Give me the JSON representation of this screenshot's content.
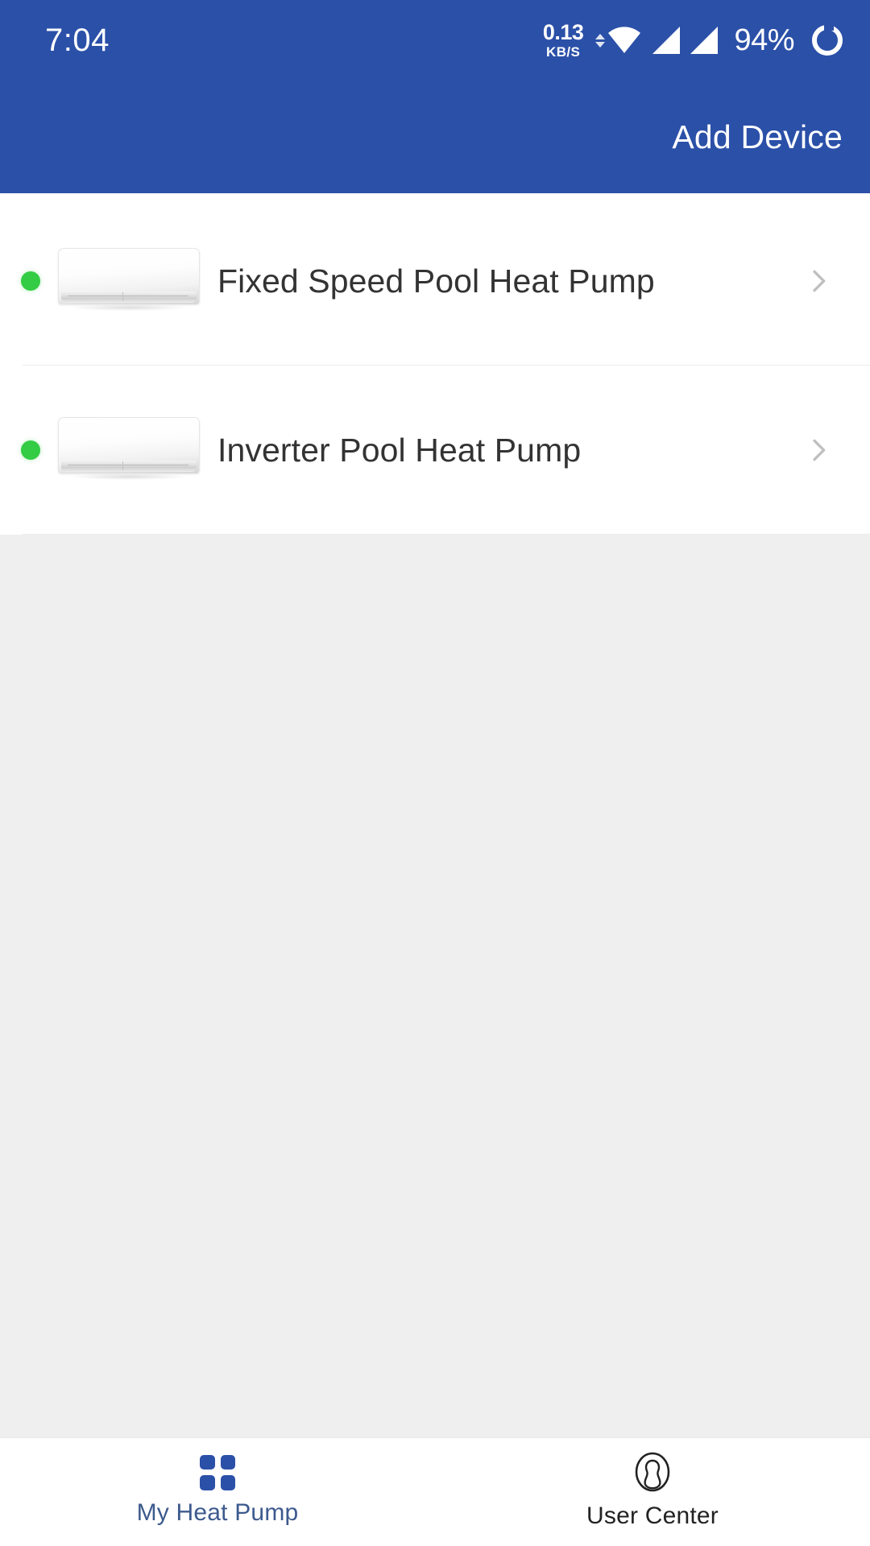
{
  "theme": {
    "header_blue": "#2b50a8",
    "accent_blue": "#2b50a8",
    "active_nav_text": "#3d5a8e",
    "online_green": "#33cc44",
    "page_background": "#efefef",
    "card_background": "#ffffff"
  },
  "status_bar": {
    "time": "7:04",
    "network_speed_value": "0.13",
    "network_speed_unit": "KB/S",
    "wifi_icon": "wifi-icon",
    "signal_icon_1": "cellular-signal-icon",
    "signal_icon_2": "cellular-signal-icon",
    "battery_percent": "94%",
    "battery_icon": "battery-ring-icon"
  },
  "header": {
    "add_device_label": "Add Device"
  },
  "device_list": {
    "items": [
      {
        "name": "Fixed Speed Pool Heat Pump",
        "status": "online",
        "status_icon": "online-status-dot",
        "thumbnail_icon": "heat-pump-unit-image",
        "chevron_icon": "chevron-right-icon"
      },
      {
        "name": "Inverter Pool Heat Pump",
        "status": "online",
        "status_icon": "online-status-dot",
        "thumbnail_icon": "heat-pump-unit-image",
        "chevron_icon": "chevron-right-icon"
      }
    ]
  },
  "bottom_nav": {
    "items": [
      {
        "label": "My Heat Pump",
        "icon": "grid-icon",
        "active": true
      },
      {
        "label": "User Center",
        "icon": "user-avatar-icon",
        "active": false
      }
    ]
  }
}
